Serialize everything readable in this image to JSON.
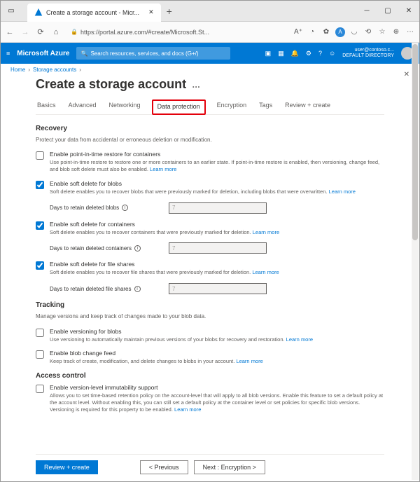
{
  "browser": {
    "tab_title": "Create a storage account - Micr...",
    "url": "https://portal.azure.com/#create/Microsoft.St..."
  },
  "azure": {
    "brand": "Microsoft Azure",
    "search_placeholder": "Search resources, services, and docs (G+/)",
    "user_email": "user@contoso.c...",
    "user_dir": "DEFAULT DIRECTORY"
  },
  "breadcrumb": {
    "home": "Home",
    "accounts": "Storage accounts"
  },
  "page_title": "Create a storage account",
  "tabs": [
    "Basics",
    "Advanced",
    "Networking",
    "Data protection",
    "Encryption",
    "Tags",
    "Review + create"
  ],
  "recovery": {
    "heading": "Recovery",
    "desc": "Protect your data from accidental or erroneous deletion or modification.",
    "pitr": {
      "label": "Enable point-in-time restore for containers",
      "desc": "Use point-in-time restore to restore one or more containers to an earlier state. If point-in-time restore is enabled, then versioning, change feed, and blob soft delete must also be enabled.",
      "learn": "Learn more"
    },
    "soft_blob": {
      "label": "Enable soft delete for blobs",
      "desc": "Soft delete enables you to recover blobs that were previously marked for deletion, including blobs that were overwritten.",
      "learn": "Learn more",
      "field_label": "Days to retain deleted blobs",
      "field_value": "7"
    },
    "soft_cont": {
      "label": "Enable soft delete for containers",
      "desc": "Soft delete enables you to recover containers that were previously marked for deletion.",
      "learn": "Learn more",
      "field_label": "Days to retain deleted containers",
      "field_value": "7"
    },
    "soft_file": {
      "label": "Enable soft delete for file shares",
      "desc": "Soft delete enables you to recover file shares that were previously marked for deletion.",
      "learn": "Learn more",
      "field_label": "Days to retain deleted file shares",
      "field_value": "7"
    }
  },
  "tracking": {
    "heading": "Tracking",
    "desc": "Manage versions and keep track of changes made to your blob data.",
    "versioning": {
      "label": "Enable versioning for blobs",
      "desc": "Use versioning to automatically maintain previous versions of your blobs for recovery and restoration.",
      "learn": "Learn more"
    },
    "changefeed": {
      "label": "Enable blob change feed",
      "desc": "Keep track of create, modification, and delete changes to blobs in your account.",
      "learn": "Learn more"
    }
  },
  "access": {
    "heading": "Access control",
    "immut": {
      "label": "Enable version-level immutability support",
      "desc": "Allows you to set time-based retention policy on the account-level that will apply to all blob versions. Enable this feature to set a default policy at the account level. Without enabling this, you can still set a default policy at the container level or set policies for specific blob versions. Versioning is required for this property to be enabled.",
      "learn": "Learn more"
    }
  },
  "footer": {
    "review": "Review + create",
    "prev": "< Previous",
    "next": "Next : Encryption >"
  }
}
